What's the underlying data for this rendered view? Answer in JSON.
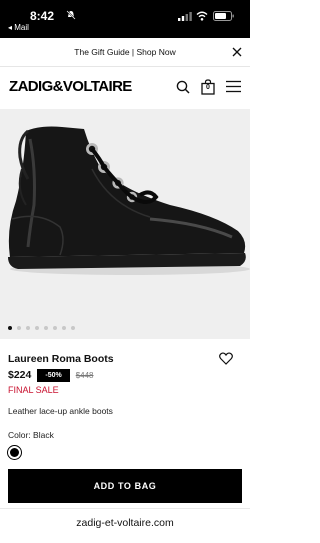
{
  "status_bar": {
    "time": "8:42",
    "back_label": "◂ Mail"
  },
  "promo": {
    "text": "The Gift Guide | Shop Now"
  },
  "header": {
    "logo": "ZADIG&VOLTAIRE",
    "bag_count": "0"
  },
  "carousel": {
    "total": 8,
    "active_index": 0
  },
  "product": {
    "name": "Laureen Roma Boots",
    "price": "$224",
    "discount": "-50%",
    "original_price": "$448",
    "final_sale": "FINAL SALE",
    "description": "Leather lace-up ankle boots",
    "color_label": "Color: Black"
  },
  "cta": {
    "add_to_bag": "ADD TO BAG"
  },
  "browser": {
    "url": "zadig-et-voltaire.com"
  },
  "colors": {
    "sale_red": "#c8102e",
    "primary": "#000000",
    "image_bg": "#efefef"
  }
}
